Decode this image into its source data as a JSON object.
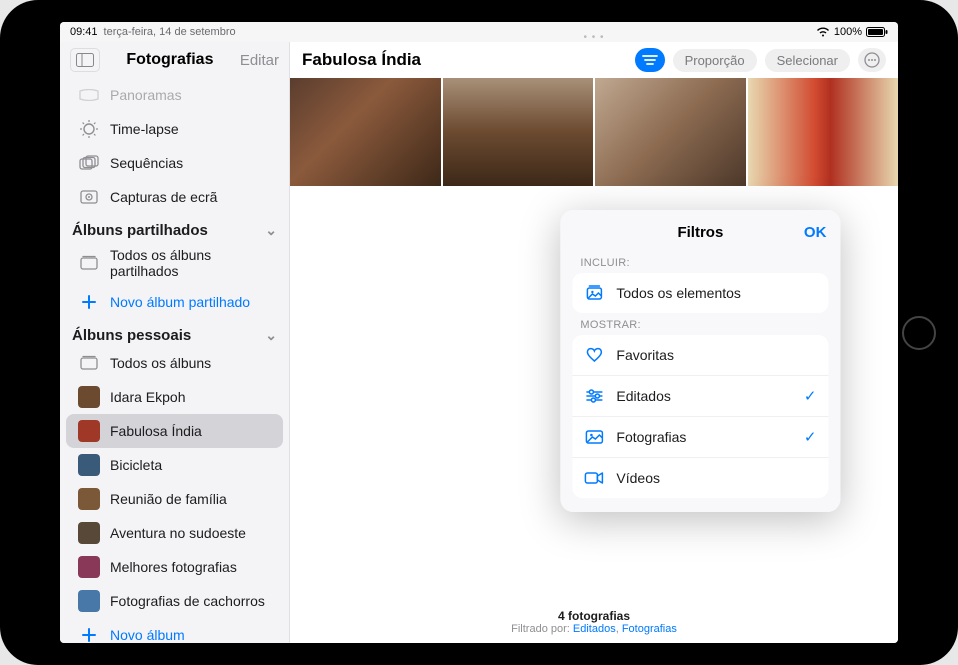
{
  "statusbar": {
    "time": "09:41",
    "date": "terça-feira, 14 de setembro",
    "battery": "100%"
  },
  "sidebar": {
    "title": "Fotografias",
    "edit": "Editar",
    "truncated_item": "Panoramas",
    "media_types": [
      {
        "label": "Time‑lapse",
        "icon": "timelapse"
      },
      {
        "label": "Sequências",
        "icon": "burst"
      },
      {
        "label": "Capturas de ecrã",
        "icon": "screenshot"
      }
    ],
    "shared_section": "Álbuns partilhados",
    "shared_items": [
      {
        "label": "Todos os álbuns partilhados",
        "icon": "albums"
      }
    ],
    "new_shared": "Novo álbum partilhado",
    "personal_section": "Álbuns pessoais",
    "personal_items": [
      {
        "label": "Todos os álbuns",
        "thumb": "#c8c8cc",
        "selected": false,
        "is_icon": true
      },
      {
        "label": "Idara Ekpoh",
        "thumb": "#6b4a30",
        "selected": false
      },
      {
        "label": "Fabulosa Índia",
        "thumb": "#a03828",
        "selected": true
      },
      {
        "label": "Bicicleta",
        "thumb": "#3a5a7a",
        "selected": false
      },
      {
        "label": "Reunião de família",
        "thumb": "#7a5838",
        "selected": false
      },
      {
        "label": "Aventura no sudoeste",
        "thumb": "#584838",
        "selected": false
      },
      {
        "label": "Melhores fotografias",
        "thumb": "#8a3858",
        "selected": false
      },
      {
        "label": "Fotografias de cachorros",
        "thumb": "#4878a8",
        "selected": false
      }
    ],
    "new_album": "Novo álbum"
  },
  "main": {
    "title": "Fabulosa Índia",
    "aspect_btn": "Proporção",
    "select_btn": "Selecionar",
    "footer_count": "4 fotografias",
    "footer_filter_prefix": "Filtrado por: ",
    "footer_filter_1": "Editados",
    "footer_filter_sep": ", ",
    "footer_filter_2": "Fotografias"
  },
  "popover": {
    "title": "Filtros",
    "ok": "OK",
    "include_label": "INCLUIR:",
    "include_row": "Todos os elementos",
    "show_label": "MOSTRAR:",
    "rows": [
      {
        "label": "Favoritas",
        "icon": "heart",
        "checked": false
      },
      {
        "label": "Editados",
        "icon": "sliders",
        "checked": true
      },
      {
        "label": "Fotografias",
        "icon": "photo",
        "checked": true
      },
      {
        "label": "Vídeos",
        "icon": "video",
        "checked": false
      }
    ]
  }
}
